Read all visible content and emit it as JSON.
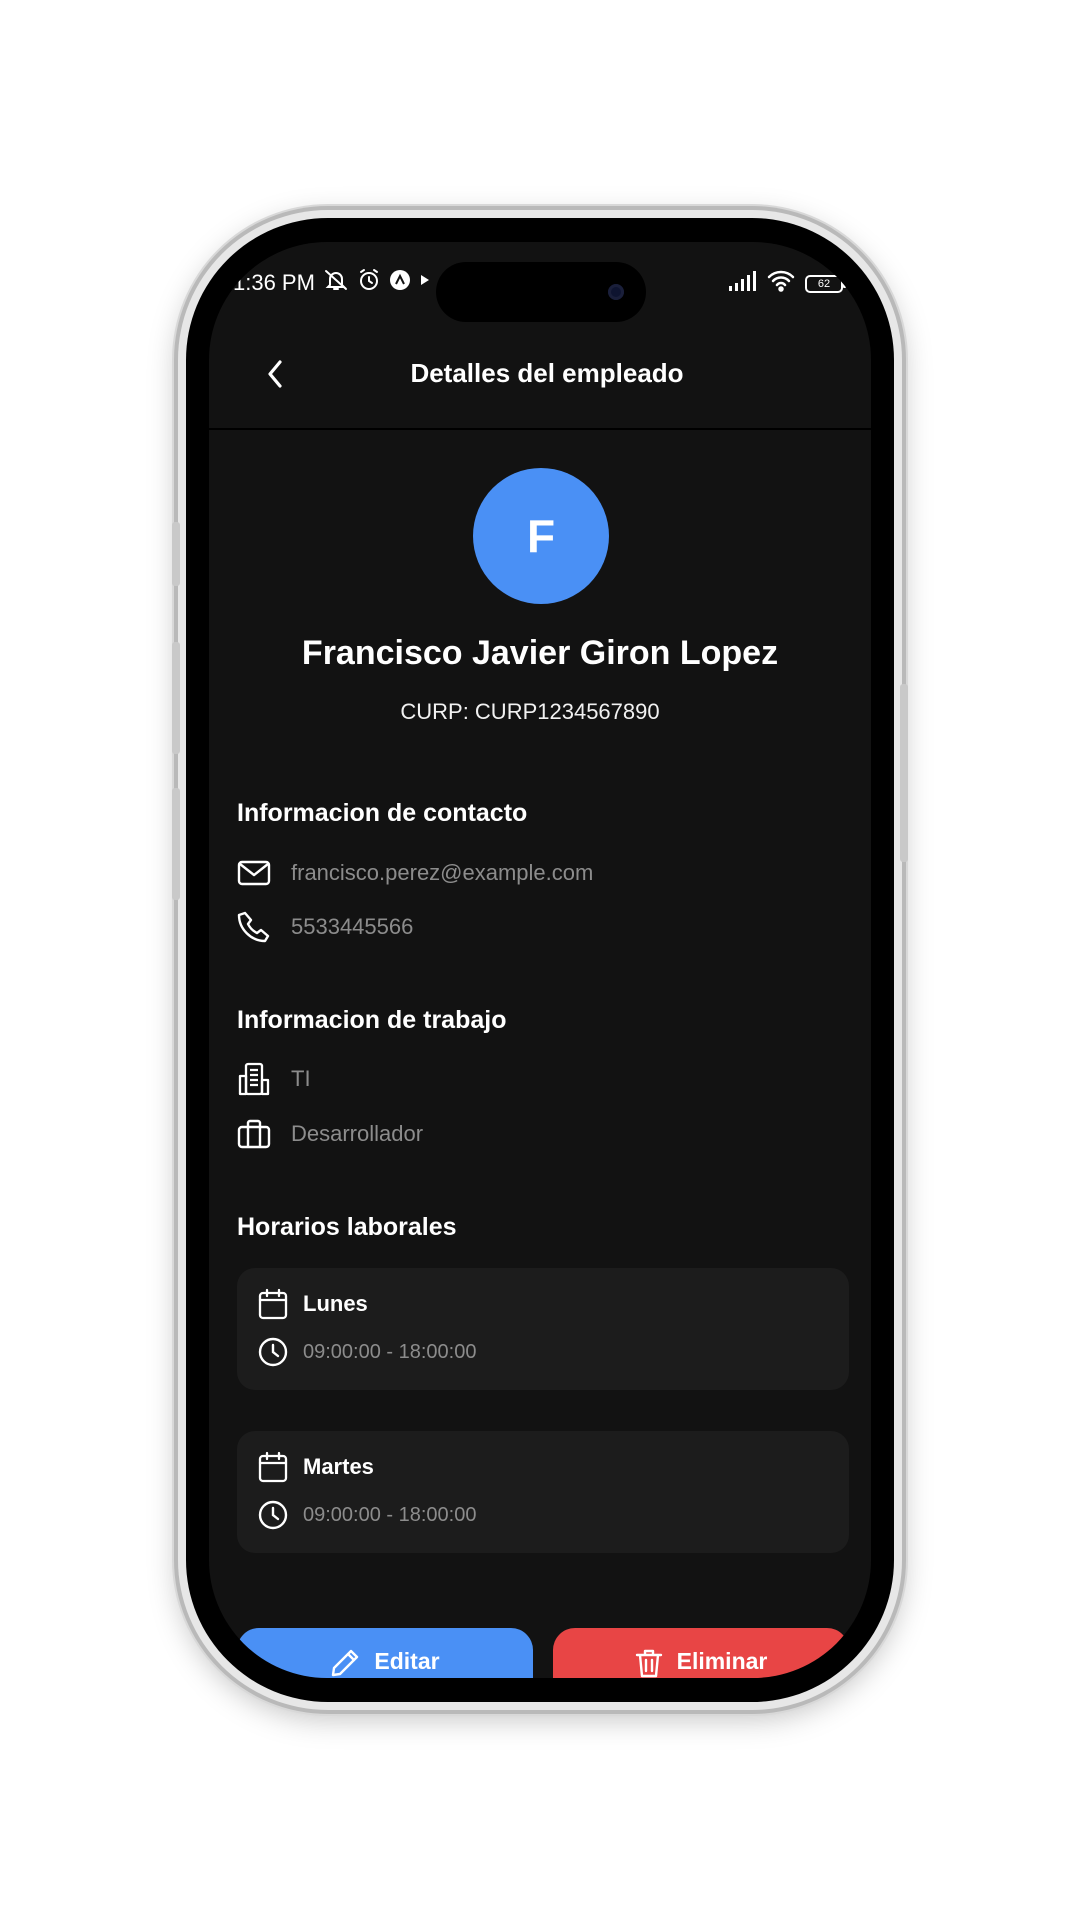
{
  "status_bar": {
    "time": "1:36 PM",
    "battery": "62",
    "left_icons": [
      "mute-icon",
      "alarm-icon",
      "app-notification-icon",
      "play-icon"
    ],
    "right_icons": [
      "signal-icon",
      "wifi-icon",
      "battery-icon"
    ]
  },
  "header": {
    "title": "Detalles del empleado",
    "back_icon": "chevron-left-icon"
  },
  "profile": {
    "initial": "F",
    "name": "Francisco Javier Giron Lopez",
    "curp": "CURP: CURP1234567890",
    "avatar_color": "#4a90f5"
  },
  "contact": {
    "title": "Informacion de contacto",
    "email": "francisco.perez@example.com",
    "phone": "5533445566"
  },
  "work": {
    "title": "Informacion de trabajo",
    "department": "TI",
    "position": "Desarrollador"
  },
  "schedule": {
    "title": "Horarios laborales",
    "items": [
      {
        "day": "Lunes",
        "hours": "09:00:00 - 18:00:00"
      },
      {
        "day": "Martes",
        "hours": "09:00:00 - 18:00:00"
      }
    ]
  },
  "actions": {
    "edit_label": "Editar",
    "delete_label": "Eliminar",
    "edit_color": "#4a90f5",
    "delete_color": "#e84545"
  }
}
